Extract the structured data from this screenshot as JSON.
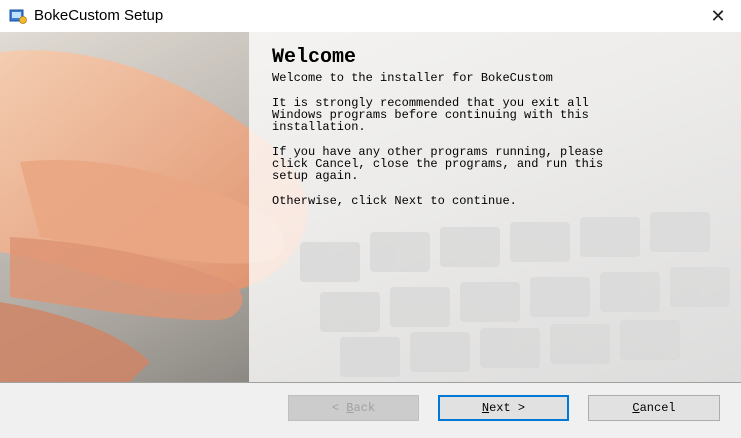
{
  "window": {
    "title": "BokeCustom Setup",
    "icon": "installer-icon",
    "close_glyph": "✕"
  },
  "welcome": {
    "heading": "Welcome",
    "intro": "Welcome to the installer for BokeCustom",
    "recommend": "It is strongly recommended that you exit all\nWindows programs before continuing with this\ninstallation.",
    "others": "If you have any other programs running, please\nclick Cancel, close the programs, and run this\nsetup again.",
    "otherwise": "Otherwise, click Next to continue."
  },
  "buttons": {
    "back": {
      "prefix": "< ",
      "accel": "B",
      "rest": "ack",
      "enabled": false
    },
    "next": {
      "prefix": "",
      "accel": "N",
      "rest": "ext >",
      "enabled": true
    },
    "cancel": {
      "prefix": "",
      "accel": "C",
      "rest": "ancel",
      "enabled": true
    }
  },
  "colors": {
    "accent": "#0078d7",
    "footer": "#f0f0f0"
  }
}
